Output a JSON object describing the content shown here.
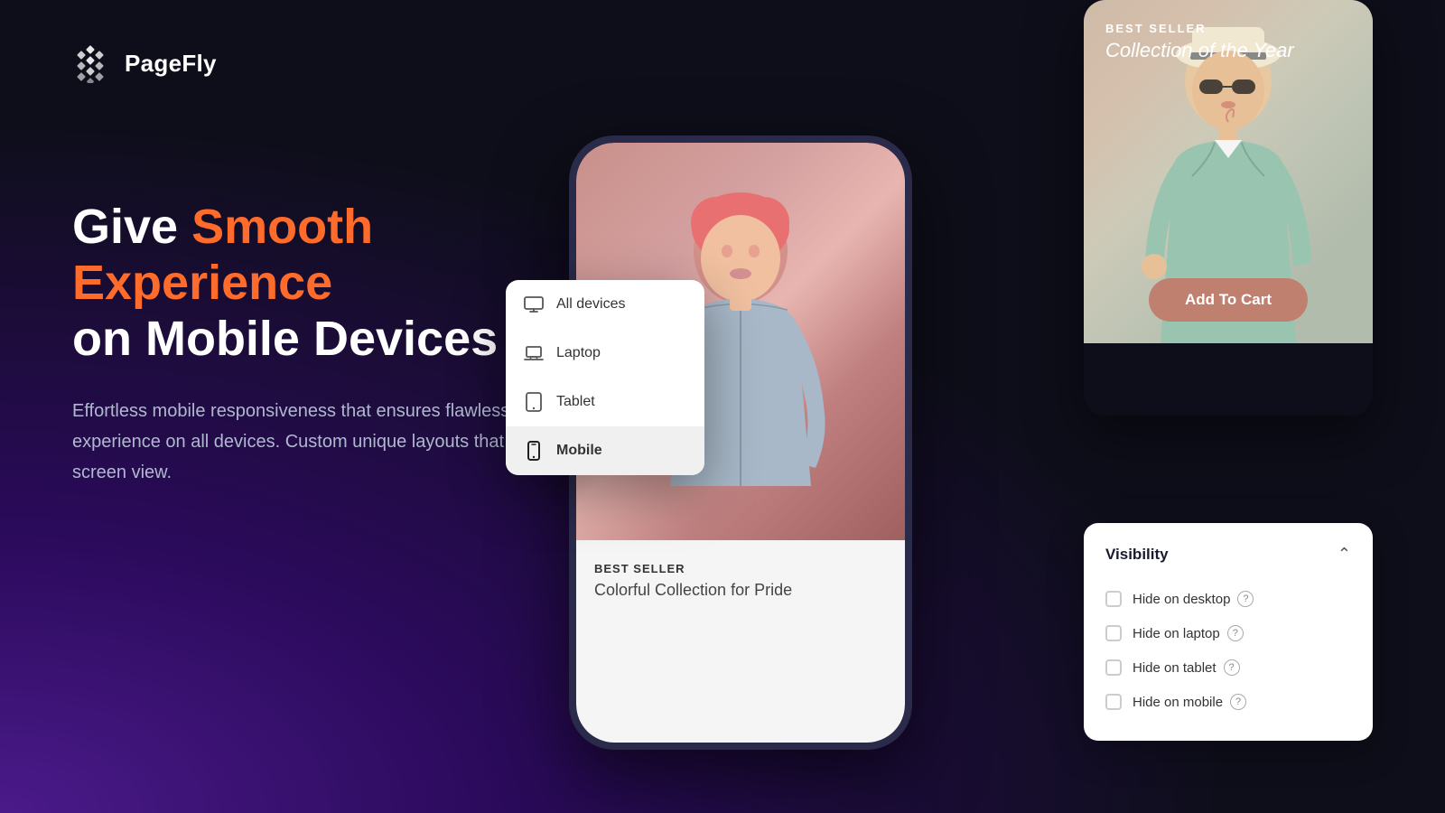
{
  "brand": {
    "name": "PageFly",
    "logo_alt": "PageFly logo"
  },
  "hero": {
    "title_prefix": "Give ",
    "title_highlight": "Smooth Experience",
    "title_suffix": "on Mobile Devices",
    "description": "Effortless mobile responsiveness that ensures flawless experience on all devices. Custom unique layouts that fit every screen view."
  },
  "device_menu": {
    "items": [
      {
        "id": "all",
        "label": "All devices",
        "icon": "monitor-icon",
        "active": false
      },
      {
        "id": "laptop",
        "label": "Laptop",
        "icon": "laptop-icon",
        "active": false
      },
      {
        "id": "tablet",
        "label": "Tablet",
        "icon": "tablet-icon",
        "active": false
      },
      {
        "id": "mobile",
        "label": "Mobile",
        "icon": "mobile-icon",
        "active": true
      }
    ]
  },
  "phone_product": {
    "badge": "BEST SELLER",
    "title": "Colorful Collection for Pride"
  },
  "product_card": {
    "badge_small": "BEST SELLER",
    "badge_title": "Collection of the Year",
    "button_label": "Add To Cart"
  },
  "visibility_panel": {
    "title": "Visibility",
    "items": [
      {
        "id": "desktop",
        "label": "Hide on desktop",
        "checked": false
      },
      {
        "id": "laptop",
        "label": "Hide on laptop",
        "checked": false
      },
      {
        "id": "tablet",
        "label": "Hide on tablet",
        "checked": false
      },
      {
        "id": "mobile",
        "label": "Hide on mobile",
        "checked": false
      }
    ]
  },
  "colors": {
    "accent": "#ff6b2b",
    "background": "#0e0e1a",
    "product_btn": "#c08070"
  }
}
